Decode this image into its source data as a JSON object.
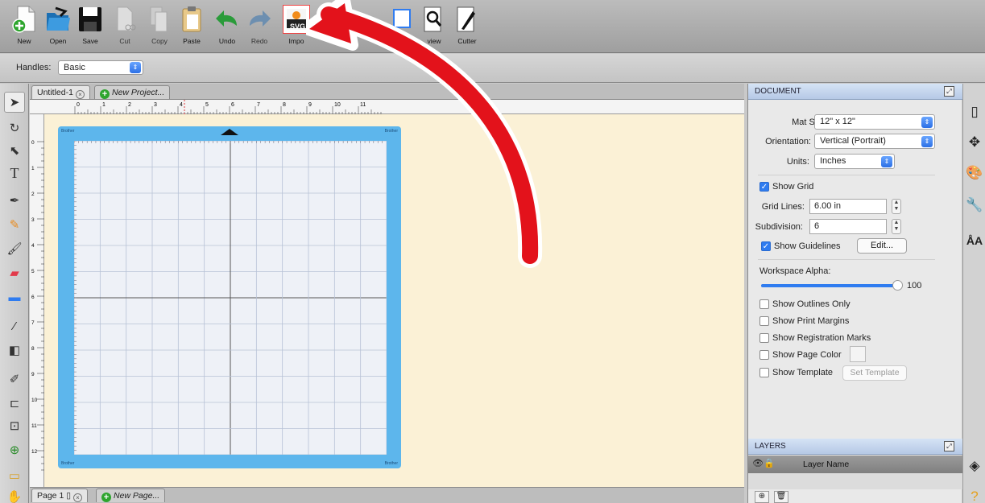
{
  "toolbar": {
    "buttons": [
      {
        "id": "new",
        "label": "New"
      },
      {
        "id": "open",
        "label": "Open"
      },
      {
        "id": "save",
        "label": "Save"
      },
      {
        "id": "cut",
        "label": "Cut"
      },
      {
        "id": "copy",
        "label": "Copy"
      },
      {
        "id": "paste",
        "label": "Paste"
      },
      {
        "id": "undo",
        "label": "Undo"
      },
      {
        "id": "redo",
        "label": "Redo"
      },
      {
        "id": "import",
        "label": "Impo"
      },
      {
        "id": "preview",
        "label": "view"
      },
      {
        "id": "cutter",
        "label": "Cutter"
      }
    ],
    "svg_badge": "SVG"
  },
  "options_bar": {
    "handles_label": "Handles:",
    "handles_value": "Basic"
  },
  "doc_tabs": {
    "active": "Untitled-1",
    "new_project": "New Project..."
  },
  "ruler": {
    "h_ticks": [
      "0",
      "1",
      "2",
      "3",
      "4",
      "5",
      "6",
      "7",
      "8",
      "9",
      "10",
      "11"
    ],
    "v_ticks": [
      "0",
      "1",
      "2",
      "3",
      "4",
      "5",
      "6",
      "7",
      "8",
      "9",
      "10",
      "11",
      "12"
    ]
  },
  "mat": {
    "brand": "Brother",
    "color": "#5db6ec"
  },
  "page_bar": {
    "page": "Page 1",
    "new_page": "New Page..."
  },
  "document_panel": {
    "title": "DOCUMENT",
    "mat_size_label": "Mat Size:",
    "mat_size_value": "12\" x 12\"",
    "orientation_label": "Orientation:",
    "orientation_value": "Vertical (Portrait)",
    "units_label": "Units:",
    "units_value": "Inches",
    "show_grid_label": "Show Grid",
    "show_grid_checked": true,
    "grid_lines_label": "Grid Lines:",
    "grid_lines_value": "6.00 in",
    "subdivision_label": "Subdivision:",
    "subdivision_value": "6",
    "show_guidelines_label": "Show Guidelines",
    "show_guidelines_checked": true,
    "edit_button": "Edit...",
    "workspace_alpha_label": "Workspace Alpha:",
    "workspace_alpha_value": "100",
    "show_outlines_label": "Show Outlines Only",
    "show_print_margins_label": "Show Print Margins",
    "show_registration_label": "Show Registration Marks",
    "show_page_color_label": "Show Page Color",
    "show_template_label": "Show Template",
    "set_template_button": "Set Template"
  },
  "layers_panel": {
    "title": "LAYERS",
    "column_header": "Layer Name"
  },
  "colors": {
    "accent_blue": "#2f7cf0",
    "annotation_red": "#e3121b",
    "workspace_bg": "#fbf1d6"
  }
}
